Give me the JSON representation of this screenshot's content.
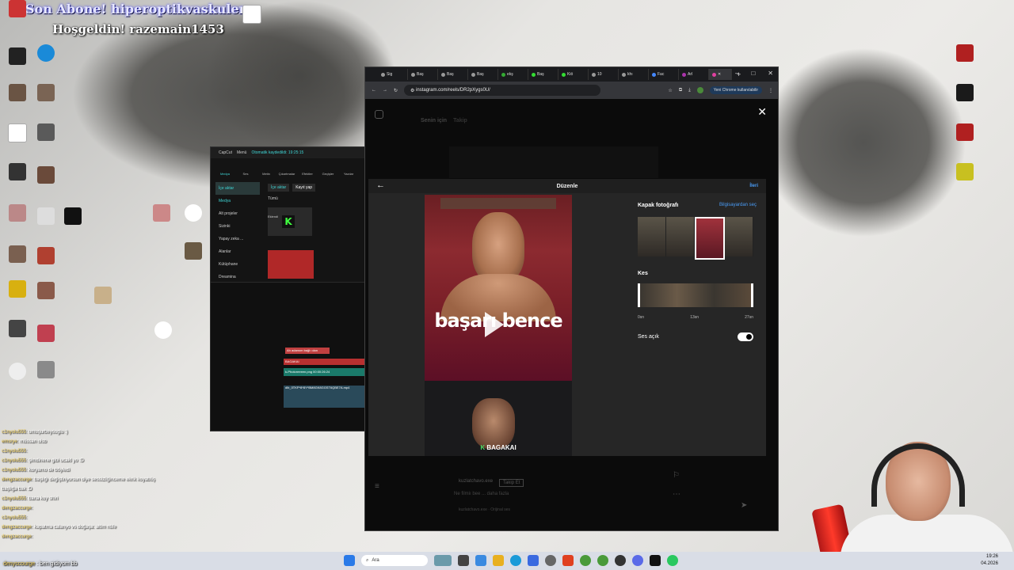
{
  "overlay": {
    "title": "Son Abone! hiperoptikvaskuler",
    "welcome": "Hoşgeldin! razemain1453"
  },
  "capcut": {
    "app": "CapCut",
    "menu": "Menü",
    "autosave": "Otomatik kaydedildi: 19:25:15",
    "tools": [
      "Medya",
      "Ses",
      "Metin",
      "Çıkartmalar",
      "Efektler",
      "Geçişler",
      "Yazılar"
    ],
    "side": [
      "İçe aktar",
      "Medya",
      "Alt projeler",
      "Sizinki",
      "Yapay zeka ...",
      "Alanlar",
      "Kütüphane",
      "Dreamina"
    ],
    "import_btn": "İçe aktar",
    "record_btn": "Kayıt yap",
    "all_label": "Tümü",
    "clip_label": "Eklendi",
    "track1": "Ah adamım bağlı olan",
    "track2": "BAGAKAI",
    "track3": "k-Photoreeeen.png  00:00:26:24",
    "track4": "dlb_0TKP*8*8Y*BM8GK8GGST6QBE7A.mp4"
  },
  "browser": {
    "tabs": [
      "Sig",
      "Baş",
      "Baş",
      "Baş",
      "ekş",
      "Baş",
      "Kiö",
      "10",
      "khı",
      "Fac",
      "Arl",
      ""
    ],
    "url": "instagram.com/reels/DR2pXygs0U/",
    "profile_btn": "Yeni Chrome kullanılabilir"
  },
  "instagram": {
    "tab_for_you": "Senin için",
    "tab_following": "Takip",
    "dialog_title": "Düzenle",
    "next": "İleri",
    "cover_heading": "Kapak fotoğrafı",
    "cover_link": "Bilgisayardan seç",
    "trim_heading": "Kes",
    "trim_ticks": [
      "0sn",
      "13sn",
      "27sn"
    ],
    "audio_label": "Ses açık",
    "audio_on": true,
    "video_text": "başarı bence",
    "video_caption_prefix": "K",
    "video_caption": "BAGAKAI",
    "bg_author": "kuzlatchavo.exe",
    "bg_follow": "Takip Et",
    "bg_desc": "Ne filmiı bee ... daha fazla",
    "bg_audio": "kuzlatchavo.exe · Orijinal ses"
  },
  "chat": {
    "lines": [
      {
        "user": "c1nyolu555",
        "msg": "umuşurbeysoglu :)"
      },
      {
        "user": "emsrye",
        "msg": "müssan olsb"
      },
      {
        "user": "c1nyolu555",
        "msg": ""
      },
      {
        "user": "c1nyolu555",
        "msg": "şimdinene gibi ucakl yo :D"
      },
      {
        "user": "c1nyolu555",
        "msg": "koryamo de böyledi"
      },
      {
        "user": "dengzaccurge",
        "msg": "başlığı değiştiriyorsun diye sessizliğinceme ekrik koyabüş"
      },
      {
        "user": "",
        "msg": "başlığa bak :D"
      },
      {
        "user": "c1nyolu555",
        "msg": "bana koy shiri"
      },
      {
        "user": "dengzaccurge",
        "msg": ""
      },
      {
        "user": "c1nyolu555",
        "msg": ""
      },
      {
        "user": "dengzaccurge",
        "msg": "kapatma calanyo vs doğaşa: altim nûfe"
      },
      {
        "user": "dengzaccurge",
        "msg": ""
      }
    ],
    "last_user": "denyscourge",
    "last_msg": "ben gidiyom bb"
  },
  "taskbar": {
    "search": "Ara",
    "time": "19:26",
    "date": "04.2026"
  },
  "colors": {
    "ig_blue": "#4a9df8",
    "capcut_accent": "#3fd6d6",
    "video_red": "#8c2a30"
  }
}
